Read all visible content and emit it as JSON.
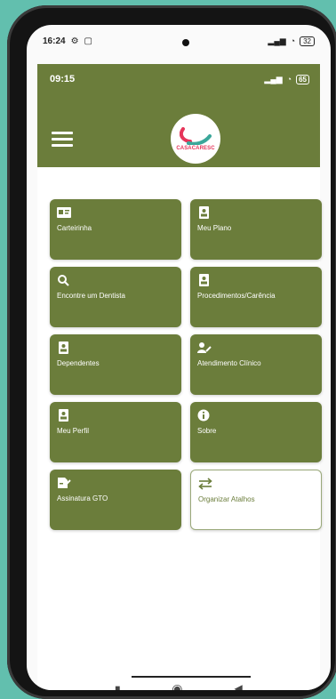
{
  "device_status": {
    "time": "16:24",
    "battery": "32"
  },
  "app_status": {
    "time": "09:15",
    "battery": "65"
  },
  "logo": {
    "text": "CASACARESC"
  },
  "tiles": [
    {
      "label": "Carteirinha",
      "icon": "id-card-icon"
    },
    {
      "label": "Meu Plano",
      "icon": "badge-icon"
    },
    {
      "label": "Encontre um Dentista",
      "icon": "search-icon"
    },
    {
      "label": "Procedimentos/Carência",
      "icon": "badge-icon"
    },
    {
      "label": "Dependentes",
      "icon": "badge-icon"
    },
    {
      "label": "Atendimento Clínico",
      "icon": "user-edit-icon"
    },
    {
      "label": "Meu Perfil",
      "icon": "badge-icon"
    },
    {
      "label": "Sobre",
      "icon": "info-icon"
    },
    {
      "label": "Assinatura GTO",
      "icon": "signature-icon"
    },
    {
      "label": "Organizar Atalhos",
      "icon": "swap-arrows-icon"
    }
  ],
  "colors": {
    "brand": "#6b7d3b",
    "background": "#62bfae",
    "logo_red": "#e6355a",
    "logo_teal": "#3aa79a"
  }
}
